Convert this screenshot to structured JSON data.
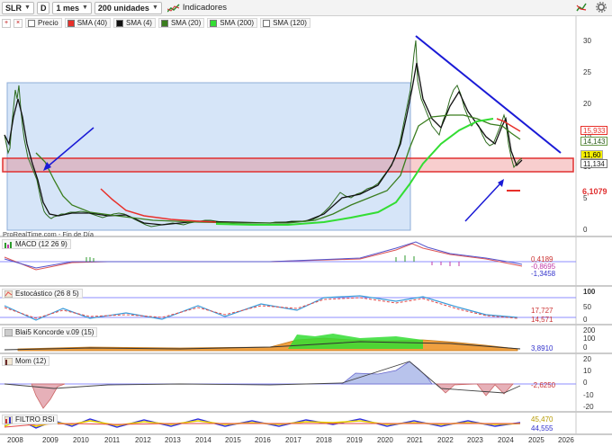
{
  "toolbar": {
    "symbol": "SLR",
    "chart_style": "D",
    "period": "1 mes",
    "units": "200 unidades",
    "indicators_label": "Indicadores"
  },
  "main_legend": [
    {
      "label": "Precio",
      "color": "#ffffff"
    },
    {
      "label": "SMA (40)",
      "color": "#e8302a"
    },
    {
      "label": "SMA (4)",
      "color": "#111111"
    },
    {
      "label": "SMA (20)",
      "color": "#3a7d1e"
    },
    {
      "label": "SMA (200)",
      "color": "#33dd33"
    },
    {
      "label": "SMA (120)",
      "color": "#ffffff"
    }
  ],
  "watermark": "ProRealTime.com - Fin de Día",
  "price_axis": [
    "30",
    "25",
    "20",
    "15",
    "10",
    "5",
    "0"
  ],
  "price_tags": {
    "sma40": "15,933",
    "sma20": "14,143",
    "last": "11,60",
    "sma4": "11,134",
    "level": "6,1079"
  },
  "panels": {
    "macd": {
      "label": "MACD (12 26 9)",
      "tags": [
        "0,4189",
        "-0,8695",
        "-1,3458"
      ]
    },
    "stoch": {
      "label": "Estocástico (26 8 5)",
      "axis": [
        "100",
        "50",
        "0"
      ],
      "tags": [
        "17,727",
        "14,571"
      ]
    },
    "blai5": {
      "label": "Blai5 Koncorde v.09 (15)",
      "axis": [
        "200",
        "100",
        "0"
      ],
      "tags": [
        "3,8910"
      ]
    },
    "mom": {
      "label": "Mom (12)",
      "axis": [
        "20",
        "10",
        "0",
        "-10",
        "-20"
      ],
      "tags": [
        "-2,6250"
      ]
    },
    "rsi": {
      "label": "FILTRO RSI",
      "tags": [
        "45,470",
        "44,555"
      ]
    }
  },
  "years": [
    "2008",
    "2009",
    "2010",
    "2011",
    "2012",
    "2013",
    "2014",
    "2015",
    "2016",
    "2017",
    "2018",
    "2019",
    "2020",
    "2021",
    "2022",
    "2023",
    "2024",
    "2025",
    "2026"
  ],
  "colors": {
    "accent_blue": "#1a1ad6",
    "support_zone": "#e03030",
    "highlight_box": "#cfe0f7"
  }
}
